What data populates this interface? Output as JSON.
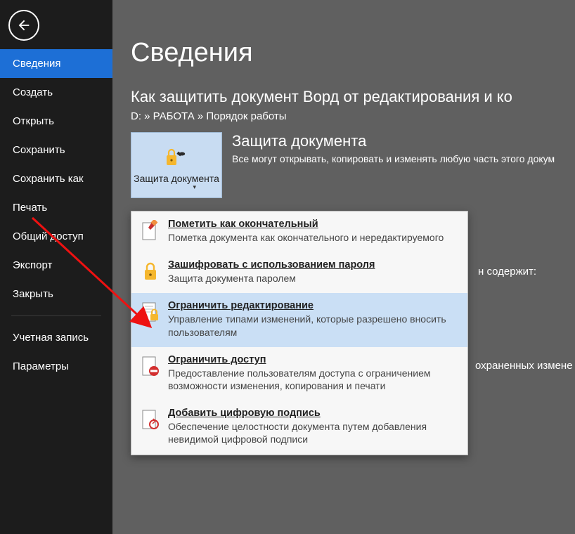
{
  "sidebar": {
    "items": [
      "Сведения",
      "Создать",
      "Открыть",
      "Сохранить",
      "Сохранить как",
      "Печать",
      "Общий доступ",
      "Экспорт",
      "Закрыть"
    ],
    "bottom_items": [
      "Учетная запись",
      "Параметры"
    ],
    "selected_index": 0
  },
  "page_title": "Сведения",
  "document": {
    "title": "Как защитить документ Ворд от редактирования и ко",
    "path": "D: » РАБОТА » Порядок работы"
  },
  "protect": {
    "button_label": "Защита документа",
    "heading": "Защита документа",
    "description": "Все могут открывать, копировать и изменять любую часть этого докум"
  },
  "menu": [
    {
      "title": "Пометить как окончательный",
      "desc": "Пометка документа как окончательного и нередактируемого",
      "icon": "mark-final-icon"
    },
    {
      "title": "Зашифровать с использованием пароля",
      "desc": "Защита документа паролем",
      "icon": "encrypt-icon"
    },
    {
      "title": "Ограничить редактирование",
      "desc": "Управление типами изменений, которые разрешено вносить пользователям",
      "icon": "restrict-editing-icon",
      "highlight": true
    },
    {
      "title": "Ограничить доступ",
      "desc": "Предоставление пользователям доступа с ограничением возможности изменения, копирования и печати",
      "icon": "restrict-access-icon"
    },
    {
      "title": "Добавить цифровую подпись",
      "desc": "Обеспечение целостности документа путем добавления невидимой цифровой подписи",
      "icon": "digital-signature-icon"
    }
  ],
  "extra": {
    "line1": "н содержит:",
    "line2": "охраненных измене"
  }
}
